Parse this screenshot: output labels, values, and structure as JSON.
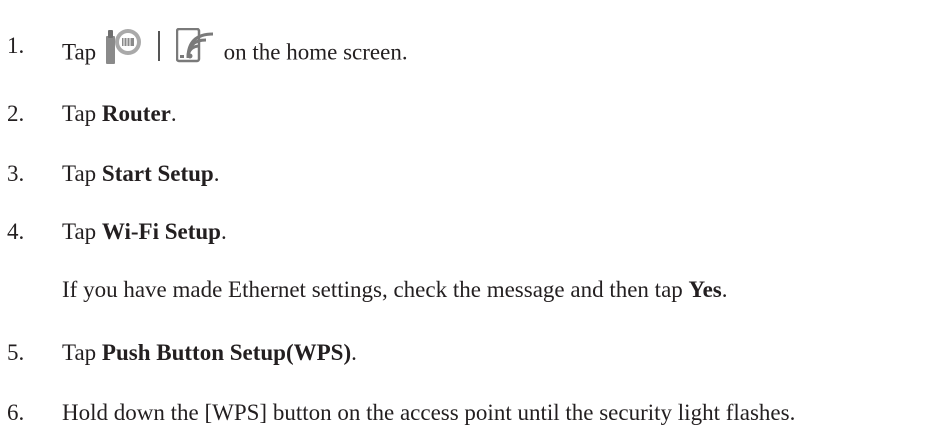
{
  "steps": [
    {
      "number": "1.",
      "before": "Tap",
      "icons": [
        "ethernet-router-icon",
        "wifi-tablet-icon"
      ],
      "after": "on the home screen."
    },
    {
      "number": "2.",
      "before": "Tap ",
      "bold": "Router",
      "after": "."
    },
    {
      "number": "3.",
      "before": "Tap ",
      "bold": "Start Setup",
      "after": "."
    },
    {
      "number": "4.",
      "before": "Tap ",
      "bold": "Wi-Fi Setup",
      "after": ".",
      "note": {
        "before": "If you have made Ethernet settings, check the message and then tap ",
        "bold": "Yes",
        "after": "."
      }
    },
    {
      "number": "5.",
      "before": "Tap ",
      "bold": "Push Button Setup(WPS)",
      "after": "."
    },
    {
      "number": "6.",
      "text": "Hold down the [WPS] button on the access point until the security light flashes."
    }
  ]
}
